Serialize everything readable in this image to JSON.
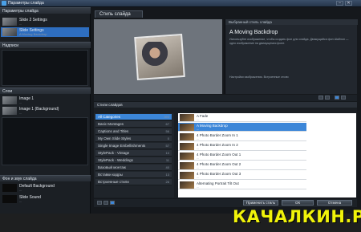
{
  "window": {
    "title": "Параметры слайда"
  },
  "left": {
    "sections": [
      "Параметры слайда",
      "Надписи",
      "Слои",
      "Фон и звук слайда"
    ],
    "slides": [
      {
        "title": "Slide 2 Settings",
        "sub": "..."
      },
      {
        "title": "Slide Settings",
        "sub": "A Moving Backdrop"
      }
    ],
    "layers": [
      {
        "title": "Image 1",
        "sub": "..."
      },
      {
        "title": "Image 1 (Background)",
        "sub": "..."
      }
    ],
    "audio": [
      {
        "title": "Default Background",
        "sub": "..."
      },
      {
        "title": "Slide Sound",
        "sub": "..."
      }
    ]
  },
  "tabs": {
    "slide_style": "Стиль слайда"
  },
  "info": {
    "header": "Выбранный стиль слайда",
    "name": "A Moving Backdrop",
    "text": "Используйте изображение, чтобы создать фон для слайда: Движущийся фон Шаблон — одно изображение на движущемся фоне.",
    "text2": "Настройки изображения. Встроенные стили"
  },
  "styles": {
    "header": "Стили слайдов",
    "categories": [
      {
        "name": "All Categories",
        "n": "393"
      },
      {
        "name": "Basic Montages",
        "n": "67"
      },
      {
        "name": "Captions and Titles",
        "n": "56"
      },
      {
        "name": "My Own Slide Styles",
        "n": "0"
      },
      {
        "name": "Single Image Embellishments",
        "n": "57"
      },
      {
        "name": "StylePack - Vintage",
        "n": "10"
      },
      {
        "name": "StylePack - Weddings",
        "n": "11"
      },
      {
        "name": "Базовый монтаж",
        "n": "40"
      },
      {
        "name": "Вставки кадры",
        "n": "13"
      },
      {
        "name": "Встроенные стили",
        "n": "26"
      }
    ],
    "rows": [
      {
        "t": "A Fade",
        "s": "..."
      },
      {
        "t": "A Moving Backdrop",
        "s": "..."
      },
      {
        "t": "4 Photo Border Zoom In 1",
        "s": "..."
      },
      {
        "t": "4 Photo Border Zoom In 2",
        "s": "..."
      },
      {
        "t": "4 Photo Border Zoom Out 1",
        "s": "..."
      },
      {
        "t": "4 Photo Border Zoom Out 2",
        "s": "..."
      },
      {
        "t": "4 Photo Border Zoom Out 3",
        "s": "..."
      },
      {
        "t": "Alternating Portrait Tilt Out",
        "s": "..."
      }
    ]
  },
  "buttons": {
    "apply": "Применить стиль",
    "ok": "ОК",
    "cancel": "Отмена"
  },
  "watermark": "КАЧАЛКИН.РУ"
}
